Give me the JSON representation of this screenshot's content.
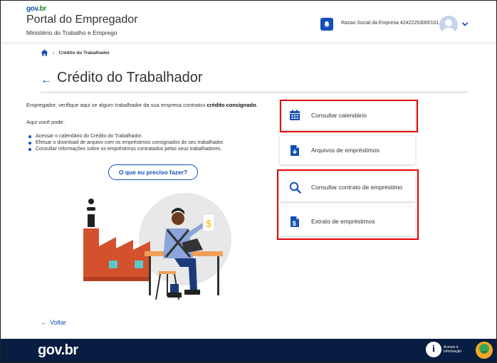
{
  "header": {
    "logo_gov": "gov",
    "logo_br": "br",
    "portal_title": "Portal do Empregador",
    "ministry": "Ministério do Trabalho e Emprego",
    "company_name": "Razao Social da Empresa 42422253000101"
  },
  "breadcrumb": {
    "current": "Crédito do Trabalhador"
  },
  "page": {
    "back_arrow": "←",
    "title": "Crédito do Trabalhador",
    "intro_prefix": "Empregador, verifique aqui se algum trabalhador da sua empresa contratou ",
    "intro_bold": "crédito consignado",
    "intro_suffix": ".",
    "here_label": "Aqui você pode:",
    "bullets": [
      "Acessar o calendário do Crédito do Trabalhador.",
      "Efetuar o download de arquivo com os empréstimos consignados do seu trabalhador.",
      "Consultar informações sobre os empréstimos contratados pelos seus trabalhadores."
    ],
    "help_button": "O que eu preciso fazer?",
    "back_link": "Voltar"
  },
  "cards": [
    {
      "label": "Consultar calendário",
      "icon": "calendar-icon"
    },
    {
      "label": "Arquivos de empréstimos",
      "icon": "file-download-icon"
    },
    {
      "label": "Consultar contrato de empréstimo",
      "icon": "search-icon"
    },
    {
      "label": "Extrato de empréstimos",
      "icon": "file-dollar-icon"
    }
  ],
  "footer": {
    "logo_gov": "gov",
    "logo_br": "br",
    "info_line1": "Acesso à",
    "info_line2": "Informação"
  },
  "colors": {
    "primary": "#1351b4",
    "footer_bg": "#071d41",
    "highlight": "#e60000"
  }
}
